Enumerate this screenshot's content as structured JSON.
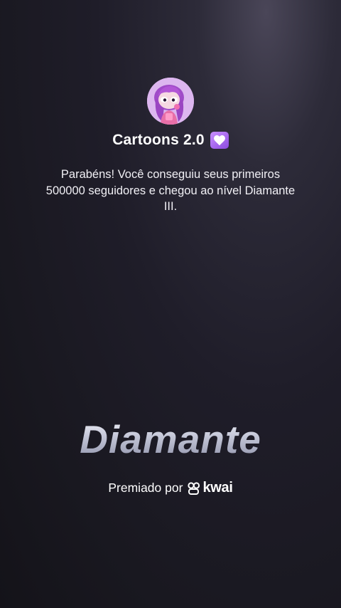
{
  "profile": {
    "channel_name": "Cartoons 2.0",
    "name_emoji": "purple-heart-icon",
    "avatar_icon": "cartoon-avatar-icon"
  },
  "message": "Parabéns! Você conseguiu seus primeiros 500000 seguidores e chegou ao nível Diamante III.",
  "rank": {
    "title": "Diamante"
  },
  "footer": {
    "awarded_label": "Premiado por",
    "brand_name": "kwai",
    "brand_icon": "kwai-logo-icon"
  },
  "colors": {
    "background": "#1f1d29",
    "text": "#ffffff",
    "emoji_heart": "#b17af5"
  }
}
